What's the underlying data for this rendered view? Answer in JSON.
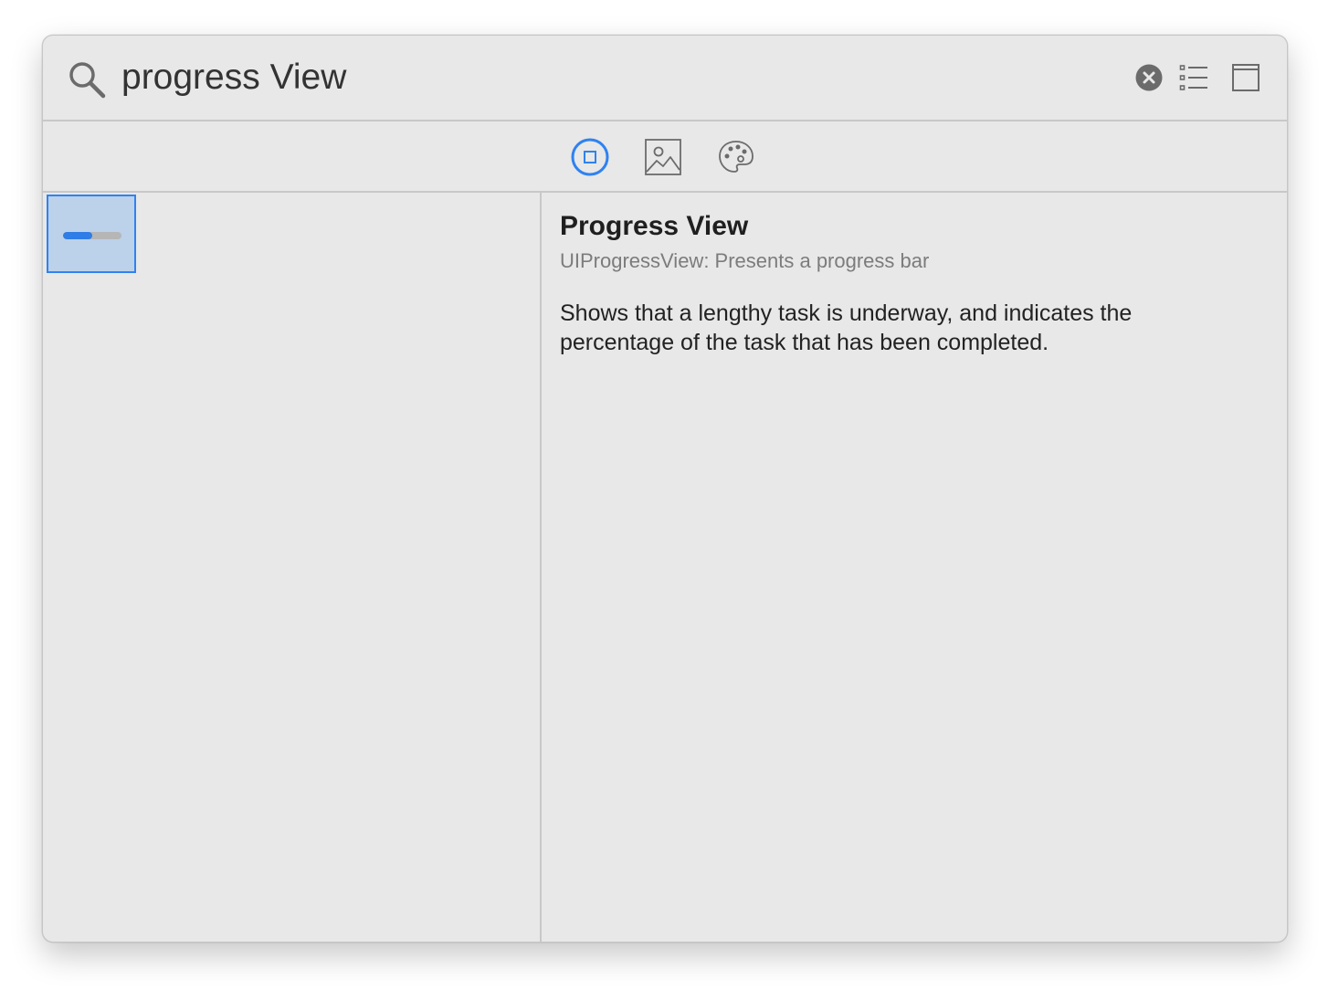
{
  "search": {
    "query": "progress View"
  },
  "toolbar": {
    "clear_icon": "clear-circle-icon",
    "list_icon": "list-view-icon",
    "detail_icon": "window-layout-icon"
  },
  "tabs": [
    {
      "name": "objects",
      "icon": "square-in-circle-icon",
      "selected": true
    },
    {
      "name": "media",
      "icon": "image-icon",
      "selected": false
    },
    {
      "name": "colors",
      "icon": "palette-icon",
      "selected": false
    }
  ],
  "results": [
    {
      "name": "progress-view",
      "icon": "progress-bar-icon",
      "progress": 0.5,
      "selected": true
    }
  ],
  "detail": {
    "title": "Progress View",
    "subtitle": "UIProgressView: Presents a progress bar",
    "description": "Shows that a lengthy task is underway, and indicates the percentage of the task that has been completed."
  },
  "colors": {
    "accent": "#2f82f0",
    "selection_bg": "#bcd1ea",
    "window_bg": "#e7e8e7",
    "icon_gray": "#6b6b6b"
  }
}
